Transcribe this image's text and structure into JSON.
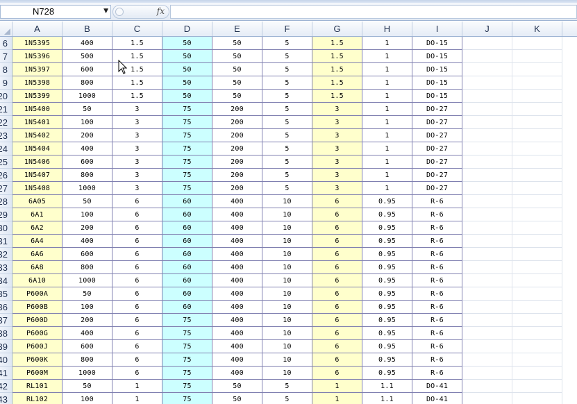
{
  "formula_bar": {
    "name_box": "N728",
    "fx_label": "fx",
    "formula": ""
  },
  "columns": [
    "A",
    "B",
    "C",
    "D",
    "E",
    "F",
    "G",
    "H",
    "I",
    "J",
    "K"
  ],
  "rows": [
    {
      "num": "6",
      "cells": [
        "1N5395",
        "400",
        "1.5",
        "50",
        "50",
        "5",
        "1.5",
        "1",
        "DO-15"
      ]
    },
    {
      "num": "7",
      "cells": [
        "1N5396",
        "500",
        "1.5",
        "50",
        "50",
        "5",
        "1.5",
        "1",
        "DO-15"
      ]
    },
    {
      "num": "8",
      "cells": [
        "1N5397",
        "600",
        "1.5",
        "50",
        "50",
        "5",
        "1.5",
        "1",
        "DO-15"
      ]
    },
    {
      "num": "9",
      "cells": [
        "1N5398",
        "800",
        "1.5",
        "50",
        "50",
        "5",
        "1.5",
        "1",
        "DO-15"
      ]
    },
    {
      "num": "20",
      "cells": [
        "1N5399",
        "1000",
        "1.5",
        "50",
        "50",
        "5",
        "1.5",
        "1",
        "DO-15"
      ]
    },
    {
      "num": "21",
      "cells": [
        "1N5400",
        "50",
        "3",
        "75",
        "200",
        "5",
        "3",
        "1",
        "DO-27"
      ]
    },
    {
      "num": "22",
      "cells": [
        "1N5401",
        "100",
        "3",
        "75",
        "200",
        "5",
        "3",
        "1",
        "DO-27"
      ]
    },
    {
      "num": "23",
      "cells": [
        "1N5402",
        "200",
        "3",
        "75",
        "200",
        "5",
        "3",
        "1",
        "DO-27"
      ]
    },
    {
      "num": "24",
      "cells": [
        "1N5404",
        "400",
        "3",
        "75",
        "200",
        "5",
        "3",
        "1",
        "DO-27"
      ]
    },
    {
      "num": "25",
      "cells": [
        "1N5406",
        "600",
        "3",
        "75",
        "200",
        "5",
        "3",
        "1",
        "DO-27"
      ]
    },
    {
      "num": "26",
      "cells": [
        "1N5407",
        "800",
        "3",
        "75",
        "200",
        "5",
        "3",
        "1",
        "DO-27"
      ]
    },
    {
      "num": "27",
      "cells": [
        "1N5408",
        "1000",
        "3",
        "75",
        "200",
        "5",
        "3",
        "1",
        "DO-27"
      ]
    },
    {
      "num": "28",
      "cells": [
        "6A05",
        "50",
        "6",
        "60",
        "400",
        "10",
        "6",
        "0.95",
        "R-6"
      ]
    },
    {
      "num": "29",
      "cells": [
        "6A1",
        "100",
        "6",
        "60",
        "400",
        "10",
        "6",
        "0.95",
        "R-6"
      ]
    },
    {
      "num": "30",
      "cells": [
        "6A2",
        "200",
        "6",
        "60",
        "400",
        "10",
        "6",
        "0.95",
        "R-6"
      ]
    },
    {
      "num": "31",
      "cells": [
        "6A4",
        "400",
        "6",
        "60",
        "400",
        "10",
        "6",
        "0.95",
        "R-6"
      ]
    },
    {
      "num": "32",
      "cells": [
        "6A6",
        "600",
        "6",
        "60",
        "400",
        "10",
        "6",
        "0.95",
        "R-6"
      ]
    },
    {
      "num": "33",
      "cells": [
        "6A8",
        "800",
        "6",
        "60",
        "400",
        "10",
        "6",
        "0.95",
        "R-6"
      ]
    },
    {
      "num": "34",
      "cells": [
        "6A10",
        "1000",
        "6",
        "60",
        "400",
        "10",
        "6",
        "0.95",
        "R-6"
      ]
    },
    {
      "num": "35",
      "cells": [
        "P600A",
        "50",
        "6",
        "60",
        "400",
        "10",
        "6",
        "0.95",
        "R-6"
      ]
    },
    {
      "num": "36",
      "cells": [
        "P600B",
        "100",
        "6",
        "60",
        "400",
        "10",
        "6",
        "0.95",
        "R-6"
      ]
    },
    {
      "num": "37",
      "cells": [
        "P600D",
        "200",
        "6",
        "75",
        "400",
        "10",
        "6",
        "0.95",
        "R-6"
      ]
    },
    {
      "num": "38",
      "cells": [
        "P600G",
        "400",
        "6",
        "75",
        "400",
        "10",
        "6",
        "0.95",
        "R-6"
      ]
    },
    {
      "num": "39",
      "cells": [
        "P600J",
        "600",
        "6",
        "75",
        "400",
        "10",
        "6",
        "0.95",
        "R-6"
      ]
    },
    {
      "num": "40",
      "cells": [
        "P600K",
        "800",
        "6",
        "75",
        "400",
        "10",
        "6",
        "0.95",
        "R-6"
      ]
    },
    {
      "num": "41",
      "cells": [
        "P600M",
        "1000",
        "6",
        "75",
        "400",
        "10",
        "6",
        "0.95",
        "R-6"
      ]
    },
    {
      "num": "42",
      "cells": [
        "RL101",
        "50",
        "1",
        "75",
        "50",
        "5",
        "1",
        "1.1",
        "DO-41"
      ]
    },
    {
      "num": "43",
      "cells": [
        "RL102",
        "100",
        "1",
        "75",
        "50",
        "5",
        "1",
        "1.1",
        "DO-41"
      ]
    }
  ],
  "fill_colors": {
    "A": "#ffffcc",
    "D": "#ccffff",
    "G": "#ffffcc"
  },
  "icons": {
    "name_box_dropdown": "triangle-down-icon",
    "select_all": "select-all-triangle-icon",
    "pointer": "mouse-pointer-icon"
  }
}
